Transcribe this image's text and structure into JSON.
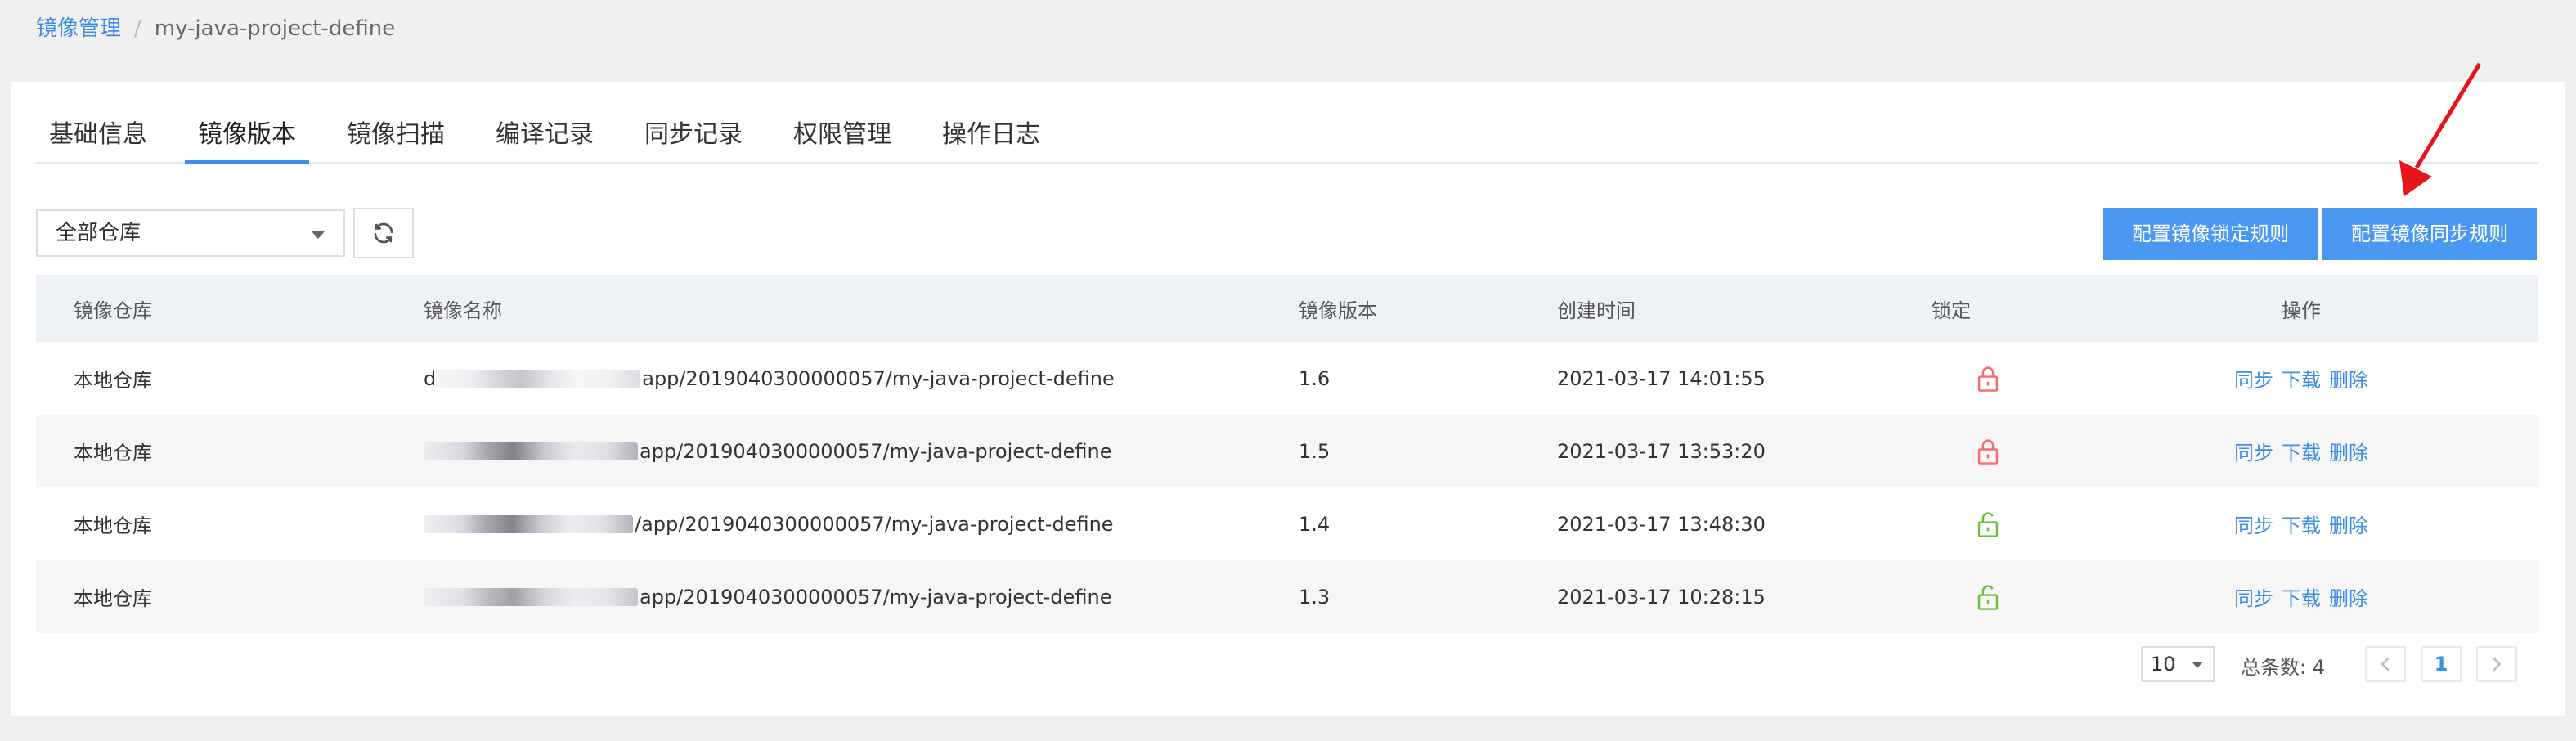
{
  "breadcrumb": {
    "root": "镜像管理",
    "separator": "/",
    "current": "my-java-project-define"
  },
  "tabs": [
    {
      "label": "基础信息"
    },
    {
      "label": "镜像版本",
      "active": true
    },
    {
      "label": "镜像扫描"
    },
    {
      "label": "编译记录"
    },
    {
      "label": "同步记录"
    },
    {
      "label": "权限管理"
    },
    {
      "label": "操作日志"
    }
  ],
  "toolbar": {
    "repo_select": "全部仓库",
    "refresh_icon": "refresh-icon",
    "lock_rule_button": "配置镜像锁定规则",
    "sync_rule_button": "配置镜像同步规则"
  },
  "table": {
    "headers": [
      "镜像仓库",
      "镜像名称",
      "镜像版本",
      "创建时间",
      "锁定",
      "操作"
    ],
    "rows": [
      {
        "repo": "本地仓库",
        "name_prefix": "d",
        "name": "app/2019040300000057/my-java-project-define",
        "version": "1.6",
        "created": "2021-03-17 14:01:55",
        "locked": true
      },
      {
        "repo": "本地仓库",
        "name_prefix": "",
        "name": "app/2019040300000057/my-java-project-define",
        "version": "1.5",
        "created": "2021-03-17 13:53:20",
        "locked": true
      },
      {
        "repo": "本地仓库",
        "name_prefix": "",
        "name": "/app/2019040300000057/my-java-project-define",
        "version": "1.4",
        "created": "2021-03-17 13:48:30",
        "locked": false
      },
      {
        "repo": "本地仓库",
        "name_prefix": "",
        "name": "app/2019040300000057/my-java-project-define",
        "version": "1.3",
        "created": "2021-03-17 10:28:15",
        "locked": false
      }
    ],
    "actions": {
      "sync": "同步",
      "download": "下载",
      "delete": "删除"
    }
  },
  "colors": {
    "accent": "#4a98f2",
    "locked": "#f56c6c",
    "unlocked": "#67c23a",
    "arrow": "#e8141c"
  },
  "pagination": {
    "page_size": "10",
    "total_label": "总条数: 4",
    "current_page": "1"
  }
}
